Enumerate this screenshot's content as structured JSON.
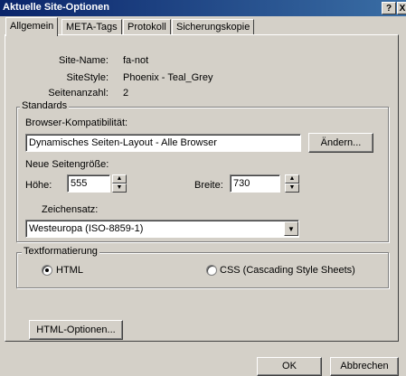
{
  "window": {
    "title": "Aktuelle Site-Optionen",
    "help_label": "?",
    "close_label": "X"
  },
  "tabs": [
    {
      "label": "Allgemein",
      "active": true
    },
    {
      "label": "META-Tags",
      "active": false
    },
    {
      "label": "Protokoll",
      "active": false
    },
    {
      "label": "Sicherungskopie",
      "active": false
    }
  ],
  "info": {
    "site_name_label": "Site-Name:",
    "site_name_value": "fa-not",
    "site_style_label": "SiteStyle:",
    "site_style_value": "Phoenix - Teal_Grey",
    "page_count_label": "Seitenanzahl:",
    "page_count_value": "2"
  },
  "standards": {
    "legend": "Standards",
    "browser_label": "Browser-Kompatibilität:",
    "browser_value": "Dynamisches Seiten-Layout - Alle Browser",
    "change_button": "Ändern...",
    "new_size_label": "Neue Seitengröße:",
    "height_label": "Höhe:",
    "height_value": "555",
    "width_label": "Breite:",
    "width_value": "730",
    "charset_label": "Zeichensatz:",
    "charset_value": "Westeuropa (ISO-8859-1)"
  },
  "text_format": {
    "legend": "Textformatierung",
    "option_html": "HTML",
    "option_css": "CSS (Cascading Style Sheets)",
    "selected": "HTML"
  },
  "html_options_button": "HTML-Optionen...",
  "footer": {
    "ok_label": "OK",
    "cancel_label": "Abbrechen"
  }
}
